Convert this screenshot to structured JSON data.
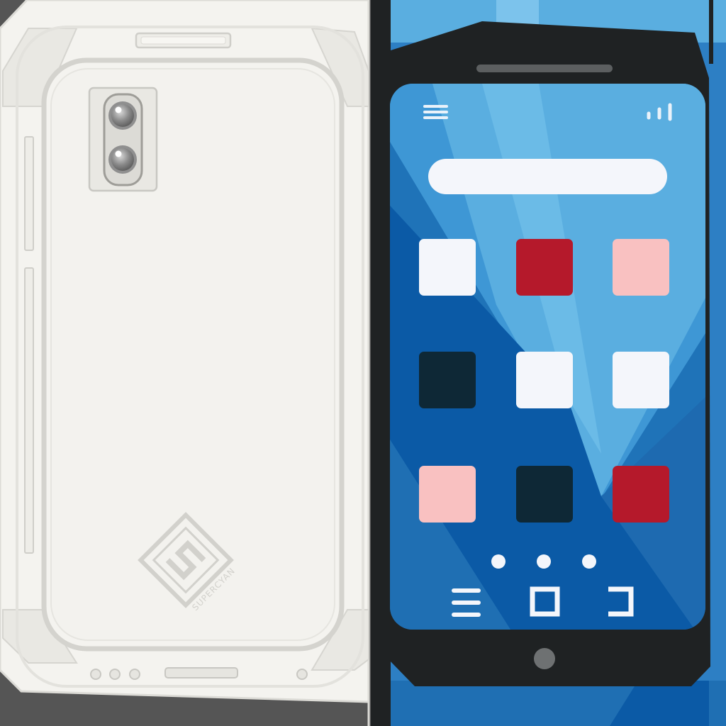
{
  "colors": {
    "background": "#555555",
    "phone_back_body": "#F4F3EF",
    "phone_back_outline": "#DEDDD8",
    "phone_front_frame": "#1F2223",
    "screen_blue": "#1F73B8",
    "screen_light_blue": "#5AAEE0",
    "screen_dark_blue": "#0B5AA6",
    "search_bar": "#F4F6FB",
    "icon_white": "#F4F6FB",
    "icon_red": "#B5192B",
    "icon_pink": "#F9C1C1",
    "icon_navy": "#0E2836"
  },
  "phone_back": {
    "logo_text": "SUPERCYAN",
    "logo_letter": "S",
    "camera_lens_count": 2
  },
  "phone_front": {
    "menu_icon": "hamburger-icon",
    "signal_icon": "signal-bars-icon",
    "search_placeholder": "",
    "app_grid": [
      [
        "white",
        "red",
        "pink"
      ],
      [
        "navy",
        "white",
        "white"
      ],
      [
        "pink",
        "navy",
        "red"
      ]
    ],
    "page_indicator_count": 3,
    "nav_icons": [
      "recents-menu-icon",
      "home-square-icon",
      "back-bracket-icon"
    ],
    "home_button": "home-button"
  }
}
